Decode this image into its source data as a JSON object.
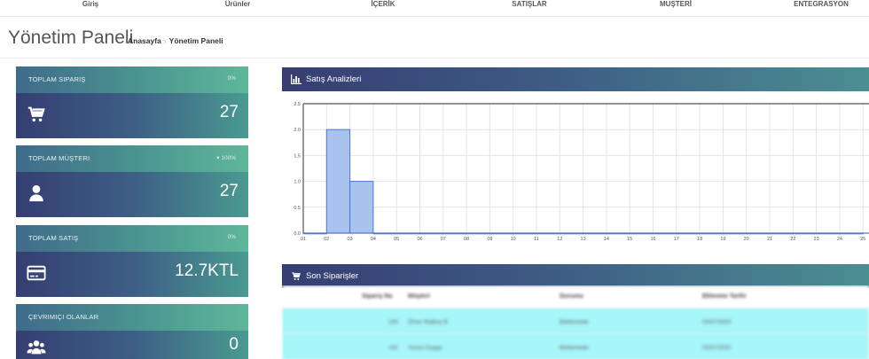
{
  "topnav": {
    "items": [
      "Giriş",
      "Ürünler",
      "İÇERİK",
      "SATIŞLAR",
      "MUŞTERİ",
      "ENTEGRASYON"
    ]
  },
  "header": {
    "title": "Yönetim Paneli",
    "breadcrumb": [
      "Anasayfa",
      "Yönetim Paneli"
    ]
  },
  "stats": [
    {
      "label": "TOPLAM SIPARIŞ",
      "percent": "0%",
      "value": "27",
      "icon": "cart-icon"
    },
    {
      "label": "TOPLAM MÜŞTERI",
      "percent": "▾ 100%",
      "value": "27",
      "icon": "user-icon"
    },
    {
      "label": "TOPLAM SATIŞ",
      "percent": "0%",
      "value": "12.7KTL",
      "icon": "credit-card-icon"
    },
    {
      "label": "ÇEVRIMIÇI OLANLAR",
      "percent": "",
      "value": "0",
      "icon": "users-icon"
    }
  ],
  "panels": {
    "sales": {
      "title": "Satış Analizleri",
      "icon": "bar-chart-icon"
    },
    "orders": {
      "title": "Son Siparişler",
      "icon": "cart-icon"
    }
  },
  "orders_table": {
    "headers": [
      "Sipariş No",
      "Müşteri",
      "Durumu",
      "Eklenme Tarihi"
    ],
    "rows": [
      [
        "143",
        "Ömer Malkoç B",
        "Beklemede",
        "02/07/2020"
      ],
      [
        "142",
        "Yunus Duygu",
        "Beklemede",
        "02/07/2020"
      ]
    ]
  },
  "colors": {
    "header_gradient_start": "#363d72",
    "header_gradient_end": "#4a8f92",
    "bar_fill": "#a9c2ee",
    "bar_stroke": "#4a78d6",
    "row_highlight": "#a6f6fa"
  },
  "chart_data": {
    "type": "bar",
    "categories": [
      "01",
      "02",
      "03",
      "04",
      "05",
      "06",
      "07",
      "08",
      "09",
      "10",
      "11",
      "12",
      "13",
      "14",
      "15",
      "16",
      "17",
      "18",
      "19",
      "20",
      "21",
      "22",
      "23",
      "24",
      "25"
    ],
    "values": [
      0,
      2,
      1,
      0,
      0,
      0,
      0,
      0,
      0,
      0,
      0,
      0,
      0,
      0,
      0,
      0,
      0,
      0,
      0,
      0,
      0,
      0,
      0,
      0,
      0
    ],
    "ylim": [
      0,
      2.5
    ],
    "yticks": [
      "0.0",
      "0.5",
      "1.0",
      "1.5",
      "2.0",
      "2.5"
    ],
    "ytick_values": [
      0,
      0.5,
      1.0,
      1.5,
      2.0,
      2.5
    ],
    "grid": true,
    "legend": "none"
  }
}
